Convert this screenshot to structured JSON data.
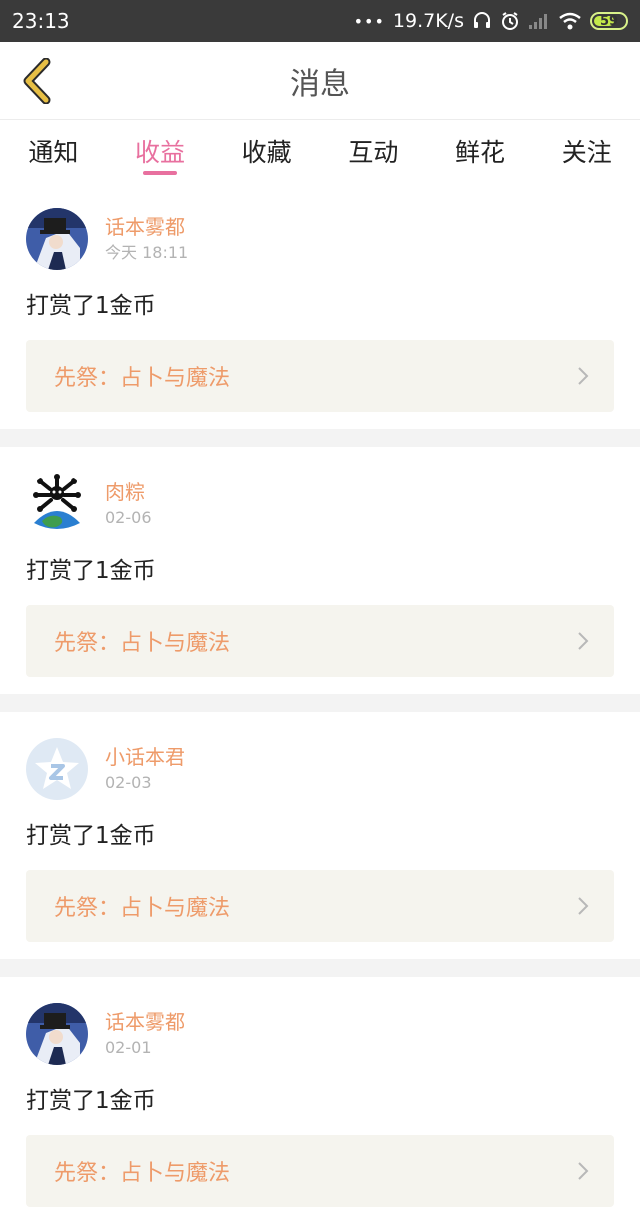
{
  "status_bar": {
    "time": "23:13",
    "dots": "•••",
    "speed": "19.7K/s",
    "battery": "59"
  },
  "header": {
    "title": "消息"
  },
  "tabs": [
    {
      "label": "通知",
      "active": false
    },
    {
      "label": "收益",
      "active": true
    },
    {
      "label": "收藏",
      "active": false
    },
    {
      "label": "互动",
      "active": false
    },
    {
      "label": "鲜花",
      "active": false
    },
    {
      "label": "关注",
      "active": false
    }
  ],
  "messages": [
    {
      "username": "话本雾都",
      "time": "今天 18:11",
      "action": "打赏了1金币",
      "book": "先祭：占卜与魔法",
      "avatar": "magician-avatar"
    },
    {
      "username": "肉粽",
      "time": "02-06",
      "action": "打赏了1金币",
      "book": "先祭：占卜与魔法",
      "avatar": "globe-avatar"
    },
    {
      "username": "小话本君",
      "time": "02-03",
      "action": "打赏了1金币",
      "book": "先祭：占卜与魔法",
      "avatar": "star-avatar"
    },
    {
      "username": "话本雾都",
      "time": "02-01",
      "action": "打赏了1金币",
      "book": "先祭：占卜与魔法",
      "avatar": "magician-avatar"
    }
  ],
  "colors": {
    "accent_pink": "#e8709f",
    "accent_orange": "#ee9b6a",
    "back_arrow": "#e7bf45"
  }
}
